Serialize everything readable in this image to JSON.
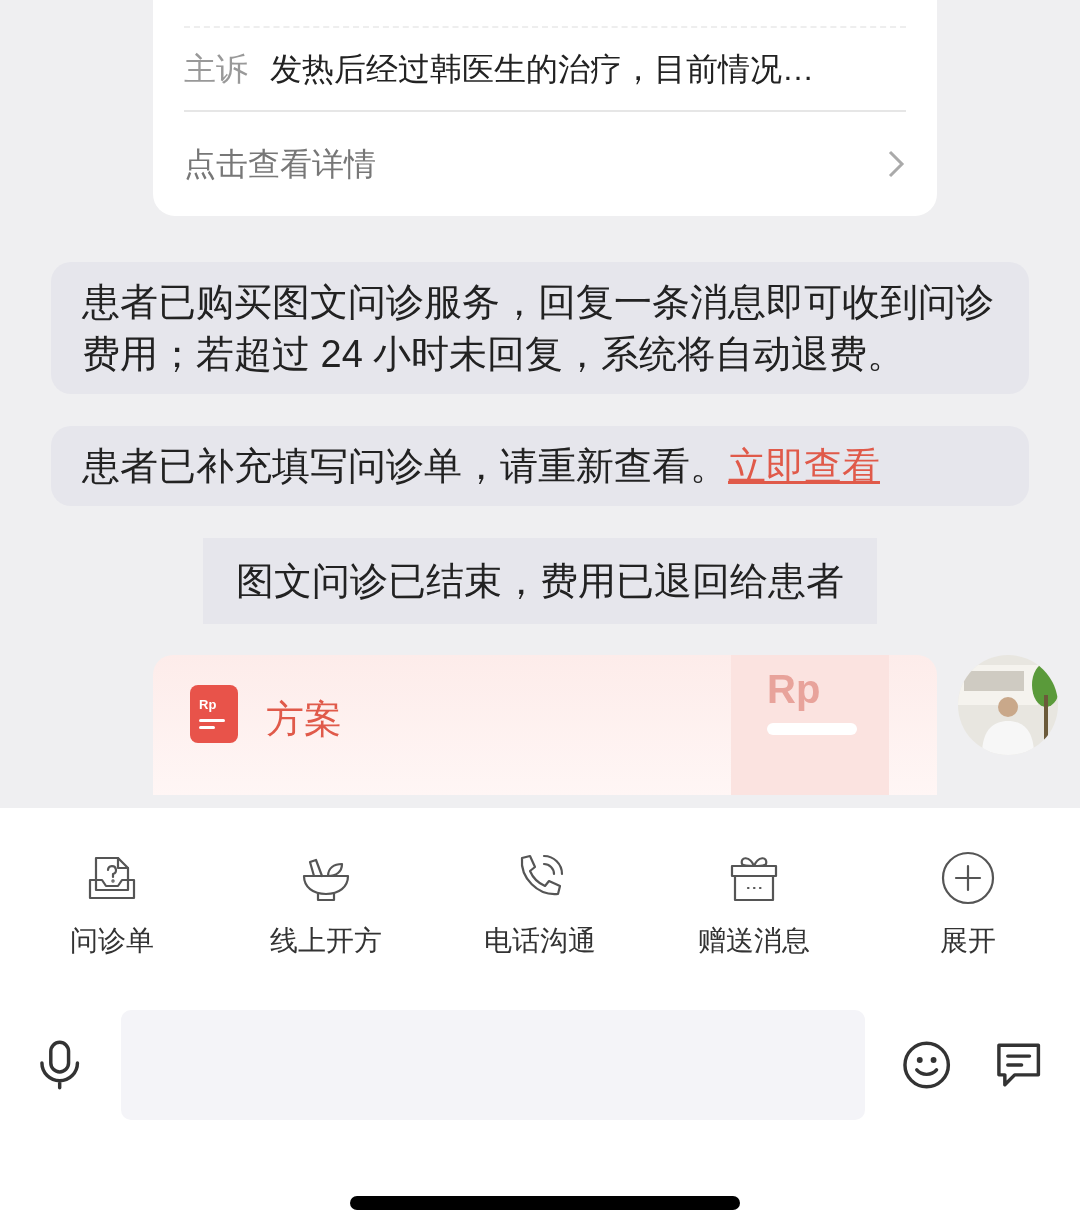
{
  "consult_card": {
    "rows": [
      {
        "label": "主诉",
        "value": "发热后经过韩医生的治疗，目前情况…"
      }
    ],
    "detail_link": "点击查看详情"
  },
  "messages": [
    {
      "kind": "notice",
      "text": "患者已购买图文问诊服务，回复一条消息即可收到问诊费用；若超过 24 小时未回复，系统将自动退费。"
    },
    {
      "kind": "notice",
      "text": "患者已补充填写问诊单，请重新查看。",
      "link": "立即查看"
    },
    {
      "kind": "status",
      "text": "图文问诊已结束，费用已退回给患者"
    }
  ],
  "plan_card": {
    "icon_text": "Rp",
    "title": "方案",
    "decor_text": "Rp"
  },
  "toolbar": [
    {
      "kind": "form",
      "label": "问诊单"
    },
    {
      "kind": "bowl",
      "label": "线上开方"
    },
    {
      "kind": "phone",
      "label": "电话沟通"
    },
    {
      "kind": "gift",
      "label": "赠送消息"
    },
    {
      "kind": "plus",
      "label": "展开"
    }
  ]
}
